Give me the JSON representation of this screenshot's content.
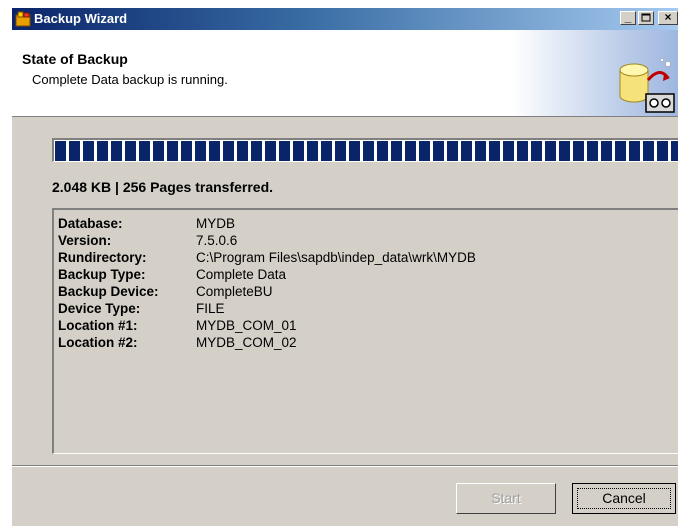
{
  "window": {
    "title": "Backup Wizard",
    "controls": [
      "minimize",
      "maximize",
      "close"
    ]
  },
  "header": {
    "title": "State of Backup",
    "subtitle": "Complete Data backup is running.",
    "graphic": "database-backup-graphic-icon"
  },
  "progress": {
    "fraction": 1.0
  },
  "transfer_status": "2.048 KB | 256 Pages transferred.",
  "details": [
    {
      "label": "Database:",
      "value": "MYDB"
    },
    {
      "label": "Version:",
      "value": "7.5.0.6"
    },
    {
      "label": "Rundirectory:",
      "value": "C:\\Program Files\\sapdb\\indep_data\\wrk\\MYDB"
    },
    {
      "label": "Backup Type:",
      "value": "Complete Data"
    },
    {
      "label": "Backup Device:",
      "value": "CompleteBU"
    },
    {
      "label": "Device Type:",
      "value": "FILE"
    },
    {
      "label": "Location #1:",
      "value": "MYDB_COM_01"
    },
    {
      "label": "Location #2:",
      "value": "MYDB_COM_02"
    }
  ],
  "buttons": {
    "start": "Start",
    "cancel": "Cancel"
  },
  "colors": {
    "titlebar_start": "#0a246a",
    "titlebar_end": "#a6caf0",
    "progress_block": "#0a246a",
    "window_face": "#d4d0c8"
  }
}
